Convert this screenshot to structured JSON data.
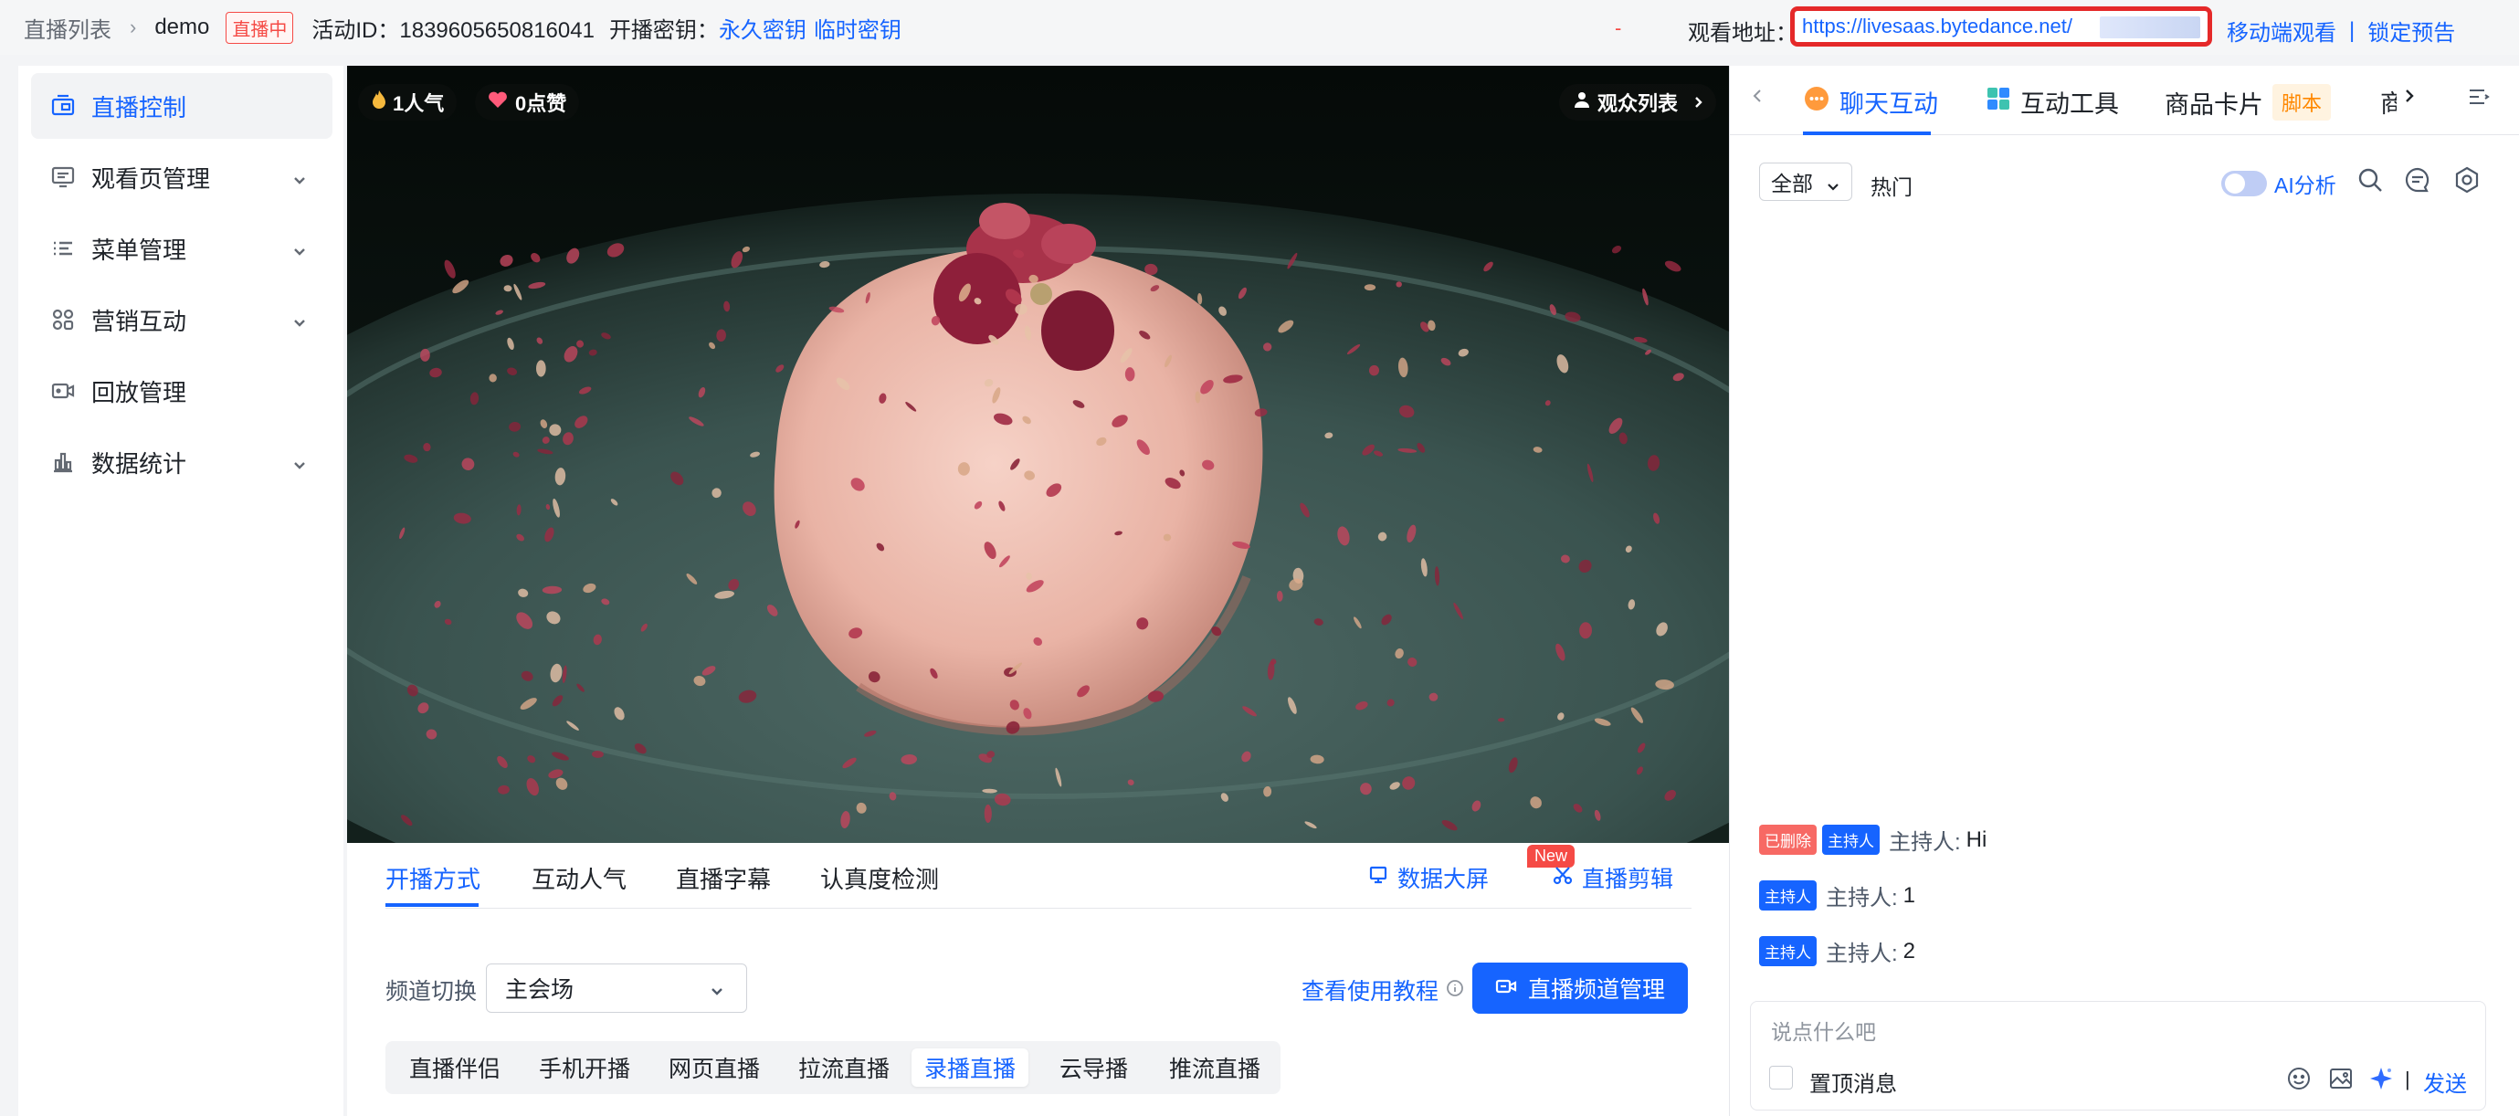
{
  "topbar": {
    "breadcrumb_root": "直播列表",
    "breadcrumb_sep": "›",
    "breadcrumb_current": "demo",
    "live_status": "直播中",
    "activity_id": "活动ID：1839605650816041",
    "stream_key_label": "开播密钥：",
    "permanent_key": "永久密钥",
    "temp_key": "临时密钥",
    "red_dash": "-",
    "watch_label": "观看地址：",
    "watch_url": "https://livesaas.bytedance.net/",
    "mobile_watch": "移动端观看",
    "separator": "|",
    "lock_preview": "锁定预告"
  },
  "sidebar": {
    "items": [
      {
        "label": "直播控制",
        "icon": "broadcast-control-icon",
        "active": true,
        "expandable": false
      },
      {
        "label": "观看页管理",
        "icon": "page-manage-icon",
        "active": false,
        "expandable": true
      },
      {
        "label": "菜单管理",
        "icon": "menu-icon",
        "active": false,
        "expandable": true
      },
      {
        "label": "营销互动",
        "icon": "marketing-icon",
        "active": false,
        "expandable": true
      },
      {
        "label": "回放管理",
        "icon": "replay-icon",
        "active": false,
        "expandable": false
      },
      {
        "label": "数据统计",
        "icon": "chart-icon",
        "active": false,
        "expandable": true
      }
    ]
  },
  "video": {
    "popularity": "1人气",
    "likes": "0点赞",
    "audience_list": "观众列表"
  },
  "controls": {
    "tabs": [
      "开播方式",
      "互动人气",
      "直播字幕",
      "认真度检测"
    ],
    "active_tab": 0,
    "data_screen": "数据大屏",
    "new_badge": "New",
    "clip": "直播剪辑",
    "channel_label": "频道切换",
    "channel_value": "主会场",
    "tutorial": "查看使用教程",
    "manage_channel": "直播频道管理",
    "modes": [
      "直播伴侣",
      "手机开播",
      "网页直播",
      "拉流直播",
      "录播直播",
      "云导播",
      "推流直播"
    ],
    "active_mode": 4
  },
  "chat_panel": {
    "tabs": [
      "聊天互动",
      "互动工具",
      "商品卡片",
      "脚本",
      "商"
    ],
    "filter_value": "全部",
    "hot_tab": "热门",
    "ai_label": "AI分析",
    "messages": [
      {
        "deleted_tag": "已删除",
        "role_tag": "主持人",
        "sender": "主持人:",
        "text": "Hi"
      },
      {
        "deleted_tag": "",
        "role_tag": "主持人",
        "sender": "主持人:",
        "text": "1"
      },
      {
        "deleted_tag": "",
        "role_tag": "主持人",
        "sender": "主持人:",
        "text": "2"
      }
    ],
    "input_placeholder": "说点什么吧",
    "pin_label": "置顶消息",
    "send_label": "发送",
    "send_sep": "|"
  },
  "colors": {
    "accent": "#1664ff",
    "danger": "#f54a45",
    "warning": "#ff8800"
  }
}
